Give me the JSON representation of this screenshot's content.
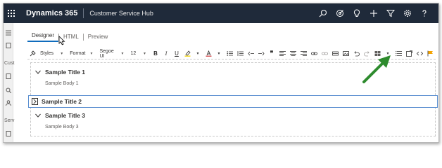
{
  "topbar": {
    "brand": "Dynamics 365",
    "app_name": "Customer Service Hub",
    "icons": [
      "search-icon",
      "target-icon",
      "lightbulb-icon",
      "plus-icon",
      "filter-icon",
      "gear-icon",
      "help-icon"
    ]
  },
  "leftrail": {
    "labels": [
      "Cust",
      "Serv"
    ]
  },
  "tabs": {
    "items": [
      {
        "label": "Designer",
        "active": true
      },
      {
        "label": "HTML",
        "active": false
      },
      {
        "label": "Preview",
        "active": false
      }
    ]
  },
  "toolbar": {
    "styles": "Styles",
    "format": "Format",
    "font": "Segoe UI",
    "size": "12",
    "bold": "B",
    "italic": "I",
    "underline": "U"
  },
  "editor": {
    "sections": [
      {
        "title": "Sample Title 1",
        "body": "Sample Body 1",
        "expanded": true
      },
      {
        "title": "Sample Title 2",
        "body": "",
        "expanded": false
      },
      {
        "title": "Sample Title 3",
        "body": "Sample Body 3",
        "expanded": true
      }
    ]
  },
  "colors": {
    "topbar_bg": "#1f2a3a",
    "accent": "#0f6cbd",
    "annotation_arrow": "#2e8b2e",
    "selection_border": "#5b8fd1"
  }
}
